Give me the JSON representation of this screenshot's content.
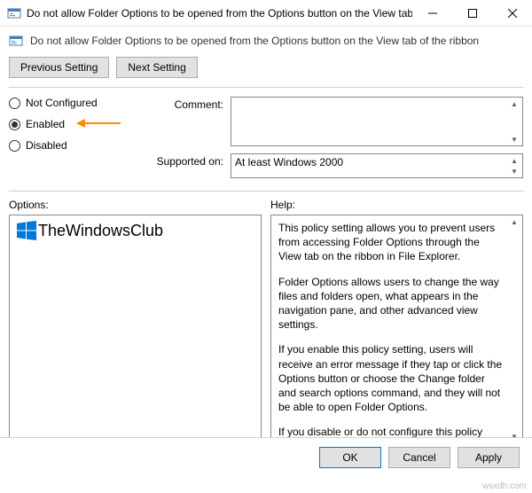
{
  "window": {
    "title": "Do not allow Folder Options to be opened from the Options button on the View tab of the ribbon"
  },
  "subtitle": "Do not allow Folder Options to be opened from the Options button on the View tab of the ribbon",
  "nav": {
    "previous": "Previous Setting",
    "next": "Next Setting"
  },
  "radios": {
    "not_configured": "Not Configured",
    "enabled": "Enabled",
    "disabled": "Disabled",
    "selected": "enabled"
  },
  "labels": {
    "comment": "Comment:",
    "supported_on": "Supported on:",
    "options": "Options:",
    "help": "Help:"
  },
  "comment_value": "",
  "supported_on_value": "At least Windows 2000",
  "options_watermark": "TheWindowsClub",
  "help_paragraphs": [
    "This policy setting allows you to prevent users from accessing Folder Options through the View tab on the ribbon in File Explorer.",
    "Folder Options allows users to change the way files and folders open, what appears in the navigation pane, and other advanced view settings.",
    "If you enable this policy setting, users will receive an error message if they tap or click the Options button or choose the Change folder and search options command, and they will not be able to open Folder Options.",
    "If you disable or do not configure this policy setting, users can open Folder Options from the View tab on the ribbon."
  ],
  "buttons": {
    "ok": "OK",
    "cancel": "Cancel",
    "apply": "Apply"
  },
  "watermark": "wsxdh.com"
}
